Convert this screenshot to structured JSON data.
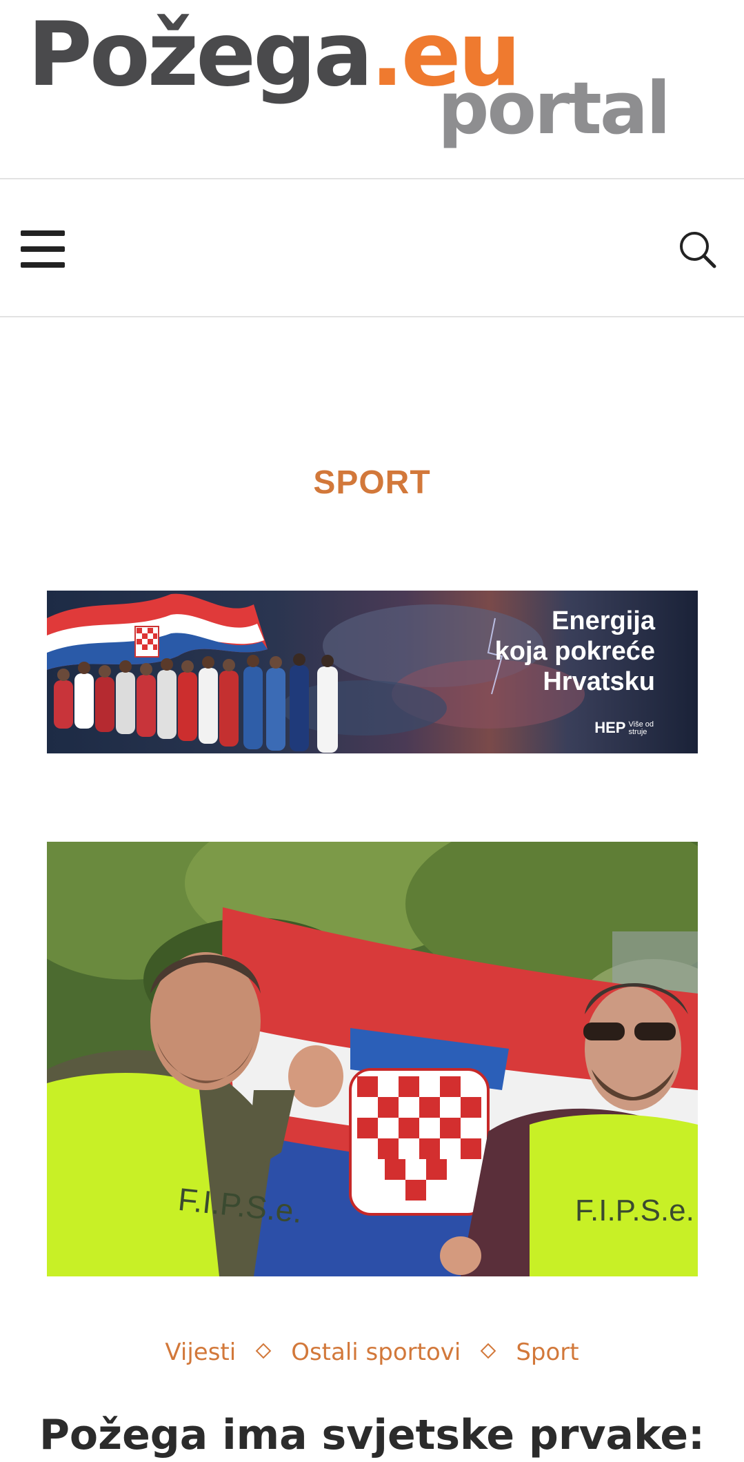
{
  "site": {
    "logo_main_dark": "Požega",
    "logo_main_orange": ".eu",
    "logo_sub": "portal",
    "colors": {
      "dark": "#4a4a4c",
      "orange": "#ef7a2f",
      "grey": "#8e8e90",
      "accent": "#d2783a"
    }
  },
  "nav": {
    "menu_icon": "hamburger-menu-icon",
    "search_icon": "search-icon"
  },
  "category": {
    "title": "SPORT"
  },
  "ad": {
    "line1": "Energija",
    "line2": "koja pokreće",
    "line3": "Hrvatsku",
    "brand": "HEP",
    "tagline_1": "Više od",
    "tagline_2": "struje"
  },
  "article": {
    "photo_vest_left": "F.I.P.S.e.",
    "photo_vest_right": "F.I.P.S.e.",
    "categories": [
      "Vijesti",
      "Ostali sportovi",
      "Sport"
    ],
    "title": "Požega ima svjetske prvake:"
  }
}
